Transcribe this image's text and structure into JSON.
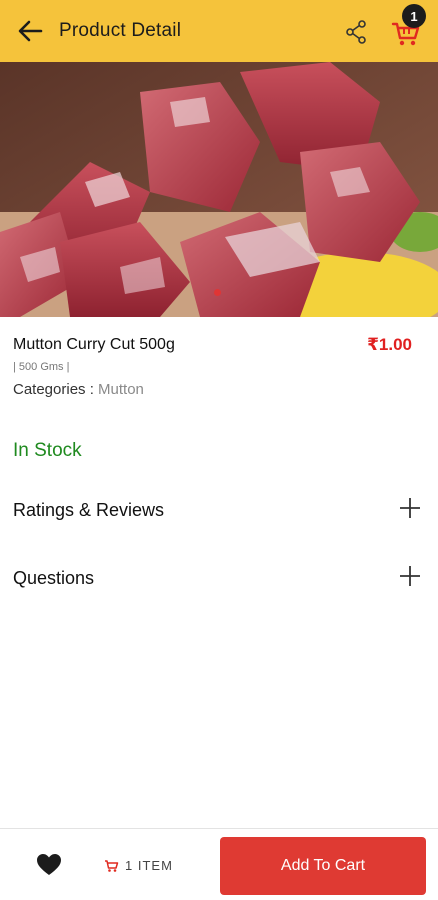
{
  "header": {
    "title": "Product Detail",
    "back_icon": "arrow-left-icon",
    "share_icon": "share-icon",
    "cart_icon": "cart-icon",
    "cart_count": "1",
    "background": "#f5c33b"
  },
  "hero": {
    "image_subject": "raw mutton pieces",
    "carousel_active_index": 1,
    "carousel_dot_color": "#e03535"
  },
  "product": {
    "name": "Mutton Curry Cut 500g",
    "price": "₹1.00",
    "weight": "| 500 Gms |",
    "categories_label": "Categories : ",
    "categories_value": "Mutton",
    "stock_status": "In Stock"
  },
  "sections": {
    "ratings_label": "Ratings & Reviews",
    "questions_label": "Questions",
    "expand_icon": "plus-icon"
  },
  "footer": {
    "wishlist_icon": "heart-icon",
    "items_icon": "cart-icon",
    "items_text": "1 ITEM",
    "add_to_cart_label": "Add To Cart",
    "accent": "#df3a33"
  },
  "colors": {
    "price": "#e02020",
    "in_stock": "#1f8a1f"
  }
}
